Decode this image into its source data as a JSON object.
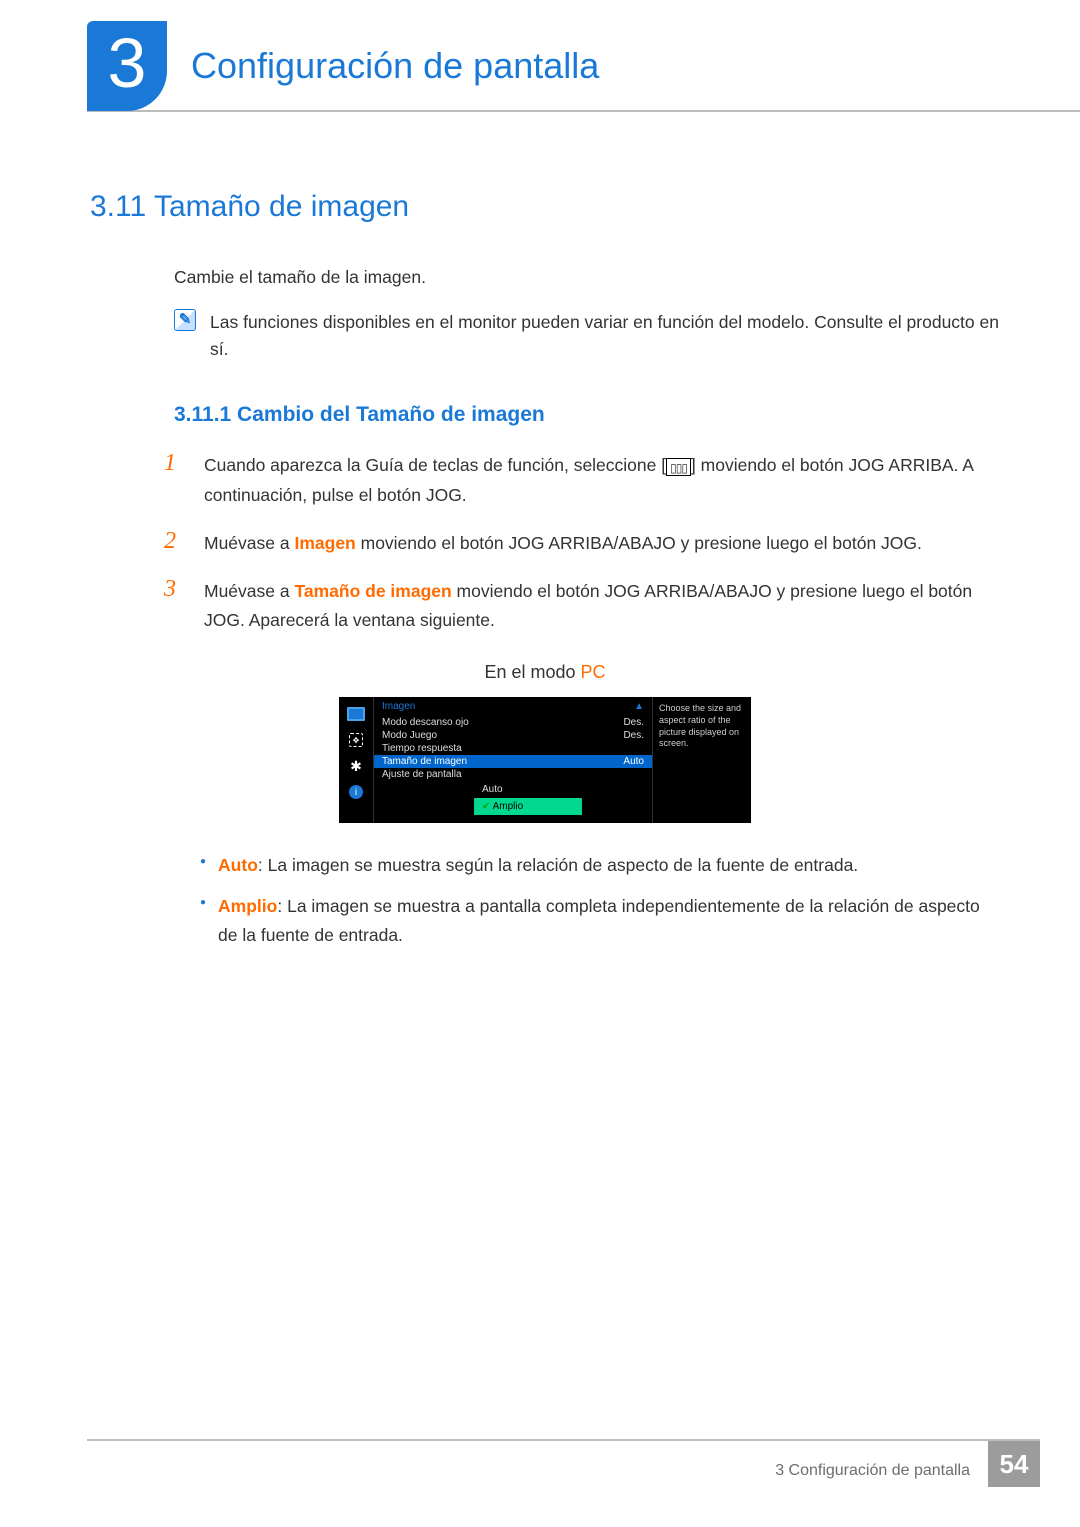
{
  "chapter": {
    "number": "3",
    "title": "Configuración de pantalla"
  },
  "section": {
    "number_title": "3.11  Tamaño de imagen"
  },
  "intro": "Cambie el tamaño de la imagen.",
  "note": {
    "icon_glyph": "✎",
    "text": "Las funciones disponibles en el monitor pueden variar en función del modelo. Consulte el producto en sí."
  },
  "subsection": {
    "number_title": "3.11.1  Cambio del Tamaño de imagen"
  },
  "steps": [
    {
      "n": "1",
      "pre": "Cuando aparezca la Guía de teclas de función, seleccione [",
      "post": "] moviendo el botón JOG ARRIBA. A continuación, pulse el botón JOG."
    },
    {
      "n": "2",
      "text_a": "Muévase a ",
      "kw": "Imagen",
      "text_b": " moviendo el botón JOG ARRIBA/ABAJO y presione luego el botón JOG."
    },
    {
      "n": "3",
      "text_a": "Muévase a ",
      "kw": "Tamaño de imagen",
      "text_b": " moviendo el botón JOG ARRIBA/ABAJO y presione luego el botón JOG. Aparecerá la ventana siguiente."
    }
  ],
  "mode_caption": {
    "prefix": "En el modo ",
    "kw": "PC"
  },
  "osd": {
    "menu_title": "Imagen",
    "arrow": "▲",
    "rows": [
      {
        "label": "Modo descanso ojo",
        "value": "Des."
      },
      {
        "label": "Modo Juego",
        "value": "Des."
      },
      {
        "label": "Tiempo respuesta",
        "value": ""
      },
      {
        "label": "Tamaño de imagen",
        "value": "Auto",
        "selected": true
      },
      {
        "label": "Ajuste de pantalla",
        "value": ""
      }
    ],
    "sub_options": [
      {
        "label": "Auto"
      },
      {
        "label": "Amplio",
        "hilite": true
      }
    ],
    "help": "Choose the size and aspect ratio of the picture displayed on screen."
  },
  "bullets": [
    {
      "kw": "Auto",
      "text": ": La imagen se muestra según la relación de aspecto de la fuente de entrada."
    },
    {
      "kw": "Amplio",
      "text": ": La imagen se muestra a pantalla completa independientemente de la relación de aspecto de la fuente de entrada."
    }
  ],
  "footer": {
    "text": "3 Configuración de pantalla",
    "page": "54"
  }
}
